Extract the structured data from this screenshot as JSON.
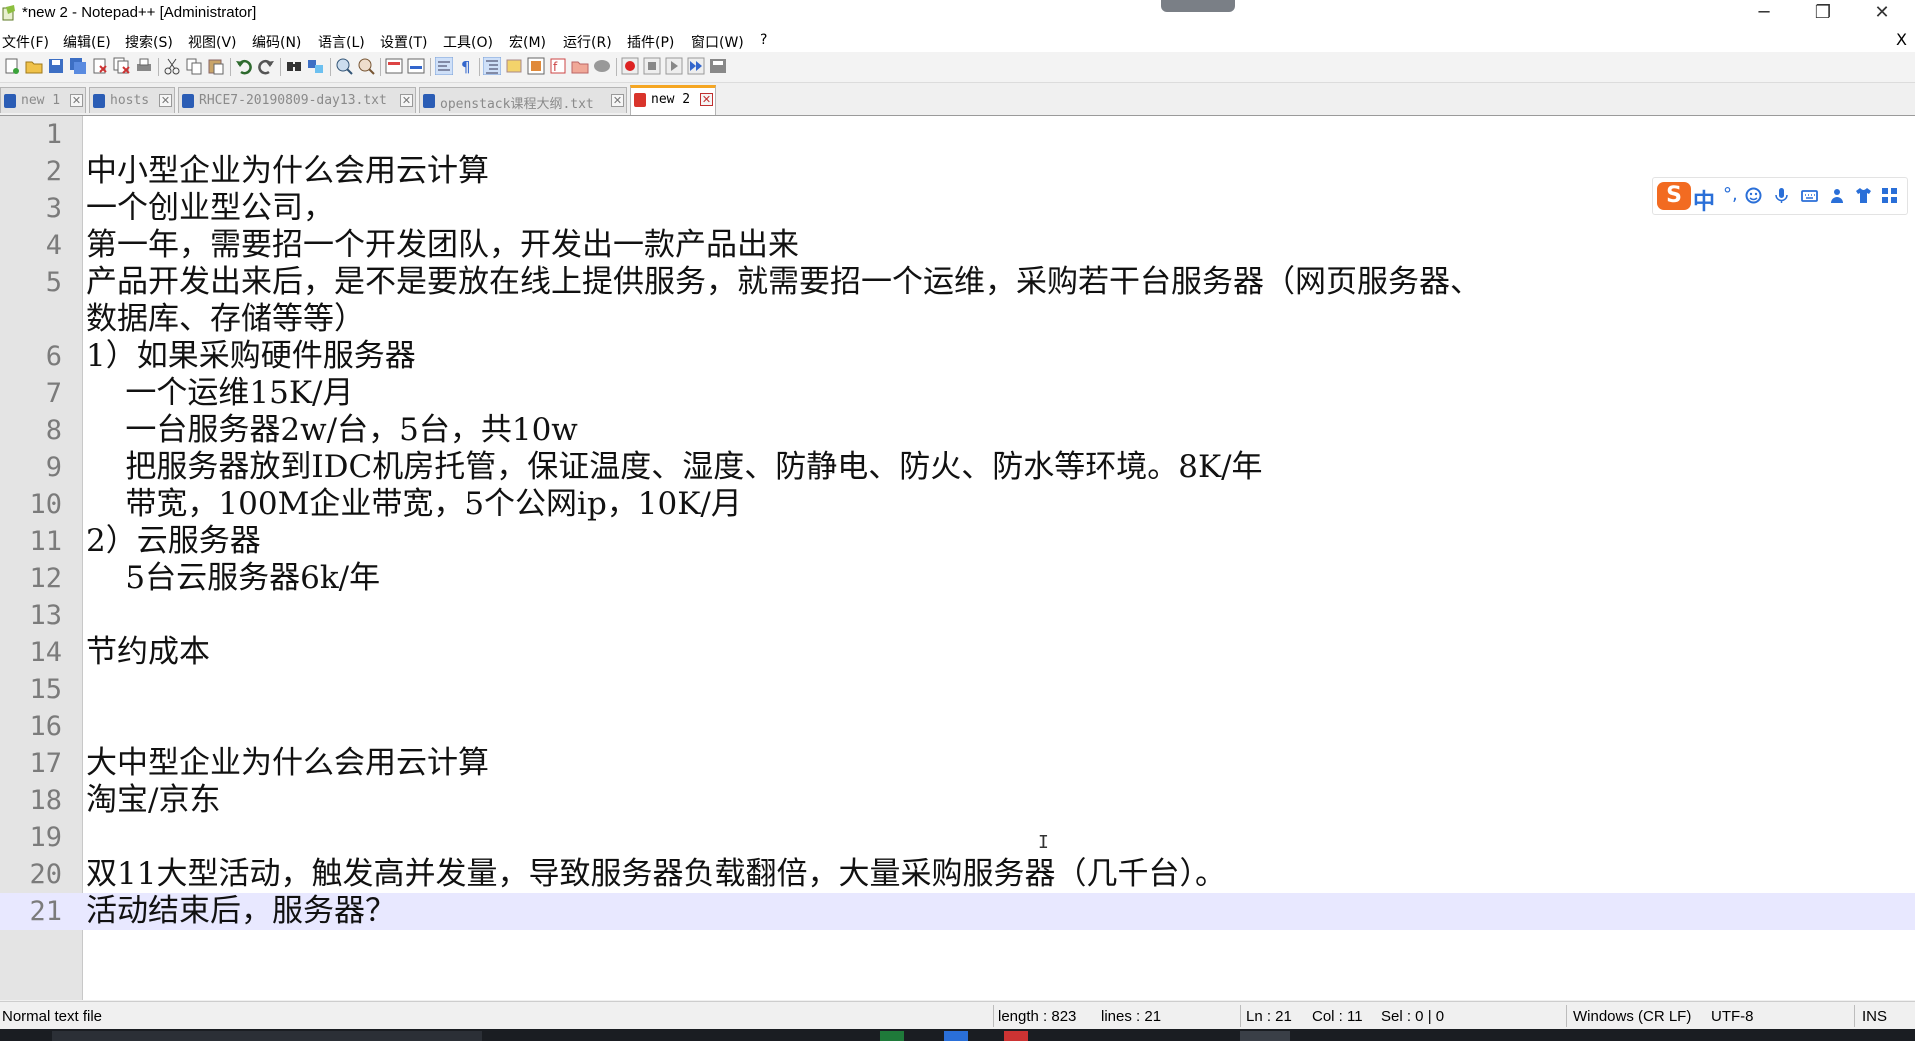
{
  "window": {
    "title": "*new 2 - Notepad++ [Administrator]",
    "minimize": "─",
    "restore": "❐",
    "close": "✕"
  },
  "menu": {
    "items": [
      "文件(F)",
      "编辑(E)",
      "搜索(S)",
      "视图(V)",
      "编码(N)",
      "语言(L)",
      "设置(T)",
      "工具(O)",
      "宏(M)",
      "运行(R)",
      "插件(P)",
      "窗口(W)",
      "?"
    ],
    "close": "X"
  },
  "toolbar": {
    "icons": [
      "new-file-icon",
      "open-file-icon",
      "save-icon",
      "save-all-icon",
      "close-icon",
      "close-all-icon",
      "print-icon",
      "cut-icon",
      "copy-icon",
      "paste-icon",
      "undo-icon",
      "redo-icon",
      "find-icon",
      "replace-icon",
      "zoom-in-icon",
      "zoom-out-icon",
      "sync-vertical-icon",
      "sync-horizontal-icon",
      "word-wrap-icon",
      "show-all-chars-icon",
      "indent-guide-icon",
      "user-lang-icon",
      "doc-map-icon",
      "function-list-icon",
      "folder-workspace-icon",
      "monitor-icon",
      "record-macro-icon",
      "stop-macro-icon",
      "play-macro-icon",
      "run-macro-multiple-icon",
      "save-macro-icon"
    ]
  },
  "tabs": [
    {
      "label": "new 1",
      "active": false
    },
    {
      "label": "hosts",
      "active": false
    },
    {
      "label": "RHCE7-20190809-day13.txt",
      "active": false
    },
    {
      "label": "openstack课程大纲.txt",
      "active": false
    },
    {
      "label": "new 2",
      "active": true
    }
  ],
  "editor": {
    "current_line": 21,
    "lines": [
      {
        "n": "1",
        "text": ""
      },
      {
        "n": "2",
        "text": "中小型企业为什么会用云计算"
      },
      {
        "n": "3",
        "text": "一个创业型公司，"
      },
      {
        "n": "4",
        "text": "第一年，需要招一个开发团队，开发出一款产品出来"
      },
      {
        "n": "5",
        "text": "产品开发出来后，是不是要放在线上提供服务，就需要招一个运维，采购若干台服务器（网页服务器、"
      },
      {
        "n": "",
        "text": "数据库、存储等等）"
      },
      {
        "n": "6",
        "text": "1）如果采购硬件服务器"
      },
      {
        "n": "7",
        "text": "    一个运维15K/月"
      },
      {
        "n": "8",
        "text": "    一台服务器2w/台，5台，共10w"
      },
      {
        "n": "9",
        "text": "    把服务器放到IDC机房托管，保证温度、湿度、防静电、防火、防水等环境。8K/年"
      },
      {
        "n": "10",
        "text": "    带宽，100M企业带宽，5个公网ip，10K/月"
      },
      {
        "n": "11",
        "text": "2）云服务器"
      },
      {
        "n": "12",
        "text": "    5台云服务器6k/年"
      },
      {
        "n": "13",
        "text": ""
      },
      {
        "n": "14",
        "text": "节约成本"
      },
      {
        "n": "15",
        "text": ""
      },
      {
        "n": "16",
        "text": ""
      },
      {
        "n": "17",
        "text": "大中型企业为什么会用云计算"
      },
      {
        "n": "18",
        "text": "淘宝/京东"
      },
      {
        "n": "19",
        "text": ""
      },
      {
        "n": "20",
        "text": "双11大型活动，触发高并发量，导致服务器负载翻倍，大量采购服务器（几千台）。"
      },
      {
        "n": "21",
        "text": "活动结束后，服务器？"
      }
    ]
  },
  "ime": {
    "logo": "S",
    "mode": "中",
    "punct": "°,",
    "icons": [
      "emoji-icon",
      "microphone-icon",
      "keyboard-icon",
      "person-icon",
      "shirt-icon",
      "grid-icon"
    ]
  },
  "status": {
    "file_type": "Normal text file",
    "length": "length : 823",
    "lines": "lines : 21",
    "ln": "Ln : 21",
    "col": "Col : 11",
    "sel": "Sel : 0 | 0",
    "eol": "Windows (CR LF)",
    "encoding": "UTF-8",
    "mode": "INS"
  },
  "colors": {
    "current_line_bg": "#e8e8ff",
    "gutter_bg": "#e4e4e4",
    "active_tab_accent": "#f5a623"
  }
}
